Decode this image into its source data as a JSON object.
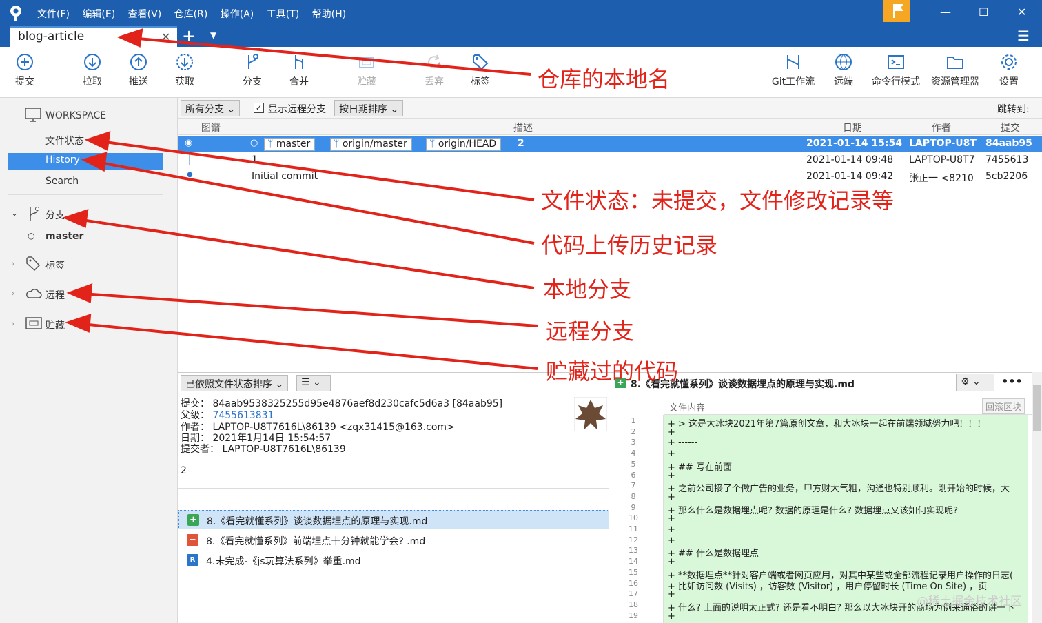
{
  "app": {
    "menu": [
      "文件(F)",
      "编辑(E)",
      "查看(V)",
      "仓库(R)",
      "操作(A)",
      "工具(T)",
      "帮助(H)"
    ],
    "tab_title": "blog-article"
  },
  "toolbar": {
    "left": [
      "提交",
      "拉取",
      "推送",
      "获取",
      "分支",
      "合并",
      "贮藏",
      "丢弃",
      "标签"
    ],
    "right": [
      "Git工作流",
      "远端",
      "命令行模式",
      "资源管理器",
      "设置"
    ]
  },
  "sidebar": {
    "workspace": "WORKSPACE",
    "file_status": "文件状态",
    "history": "History",
    "search": "Search",
    "branches": "分支",
    "master": "master",
    "tags": "标签",
    "remote": "远程",
    "stash": "贮藏"
  },
  "filter": {
    "all_branches": "所有分支",
    "show_remote": "显示远程分支",
    "sort_date": "按日期排序",
    "jump_to": "跳转到:"
  },
  "columns": {
    "graph": "图谱",
    "desc": "描述",
    "date": "日期",
    "author": "作者",
    "commit": "提交"
  },
  "commits": [
    {
      "tags": [
        "master",
        "origin/master",
        "origin/HEAD"
      ],
      "desc": "2",
      "date": "2021-01-14 15:54",
      "author": "LAPTOP-U8T",
      "hash": "84aab95"
    },
    {
      "desc": "1",
      "date": "2021-01-14 09:48",
      "author": "LAPTOP-U8T7",
      "hash": "7455613"
    },
    {
      "desc": "Initial commit",
      "date": "2021-01-14 09:42",
      "author": "张正一 <8210",
      "hash": "5cb2206"
    }
  ],
  "detail": {
    "sort_label": "已依照文件状态排序",
    "commit_k": "提交：",
    "commit_v": "84aab9538325255d95e4876aef8d230cafc5d6a3 [84aab95]",
    "parent_k": "父级：",
    "parent_v": "7455613831",
    "author_k": "作者：",
    "author_v": "LAPTOP-U8T7616L\\86139 <zqx31415@163.com>",
    "date_k": "日期：",
    "date_v": "2021年1月14日 15:54:57",
    "committer_k": "提交者：",
    "committer_v": "LAPTOP-U8T7616L\\86139",
    "message": "2"
  },
  "files": [
    {
      "status": "added",
      "name": "8.《看完就懂系列》谈谈数据埋点的原理与实现.md"
    },
    {
      "status": "removed",
      "name": "8.《看完就懂系列》前端埋点十分钟就能学会? .md"
    },
    {
      "status": "renamed",
      "name": "4.未完成-《js玩算法系列》举重.md"
    }
  ],
  "diff": {
    "file": "8.《看完就懂系列》谈谈数据埋点的原理与实现.md",
    "content_label": "文件内容",
    "rollback": "回滚区块",
    "lines": [
      "+ > 这是大冰块2021年第7篇原创文章，和大冰块一起在前端领域努力吧！！！",
      "+",
      "+ ------",
      "+",
      "+ ## 写在前面",
      "+",
      "+ 之前公司接了个做广告的业务，甲方财大气粗，沟通也特别顺利。刚开始的时候，大",
      "+",
      "+ 那么什么是数据埋点呢? 数据的原理是什么? 数据埋点又该如何实现呢?",
      "+",
      "+",
      "+",
      "+ ## 什么是数据埋点",
      "+",
      "+ **数据埋点**针对客户端或者网页应用，对其中某些或全部流程记录用户操作的日志(",
      "+ 比如访问数 (Visits) ，访客数 (Visitor) ，用户停留时长 (Time On Site) ，页",
      "+",
      "+ 什么? 上面的说明太正式? 还是看不明白? 那么以大冰块开的商场为例来通俗的讲一下",
      "+"
    ]
  },
  "annotations": [
    "仓库的本地名",
    "文件状态：未提交，文件修改记录等",
    "代码上传历史记录",
    "本地分支",
    "远程分支",
    "贮藏过的代码"
  ],
  "watermark": "@稀土掘金技术社区",
  "colors": {
    "titlebar": "#1d5fae",
    "selection": "#3d8ee8",
    "annotation": "#e2231a",
    "diff_add": "#d9f7d9"
  }
}
